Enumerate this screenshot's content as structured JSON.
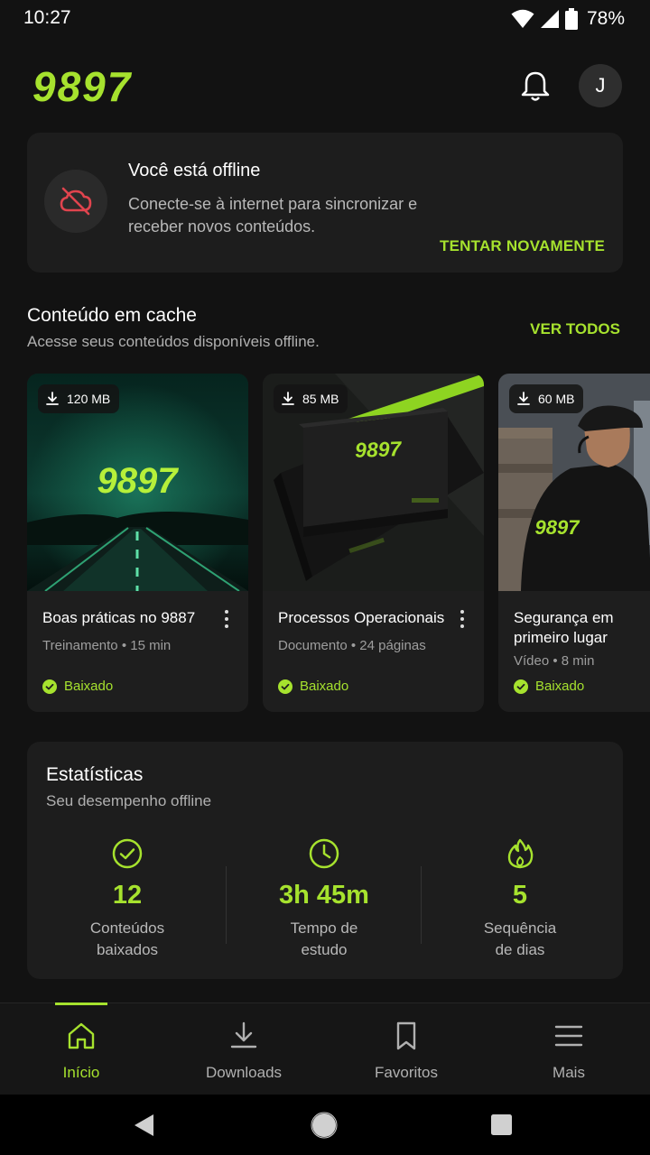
{
  "status_bar": {
    "time": "10:27",
    "battery": "78%"
  },
  "header": {
    "logo_text": "9897",
    "avatar_initial": "J"
  },
  "offline": {
    "title": "Você está offline",
    "description": "Conecte-se à internet para sincronizar e receber novos conteúdos.",
    "retry_label": "TENTAR NOVAMENTE"
  },
  "cached": {
    "title": "Conteúdo em cache",
    "subtitle": "Acesse seus conteúdos disponíveis offline.",
    "see_all_label": "VER TODOS",
    "items": [
      {
        "size": "120 MB",
        "title": "Boas práticas no 9887",
        "meta": "Treinamento • 15 min",
        "status": "Baixado",
        "image_text": "9897"
      },
      {
        "size": "85 MB",
        "title": "Processos Operacionais",
        "meta": "Documento • 24 páginas",
        "status": "Baixado",
        "image_text": "9897"
      },
      {
        "size": "60 MB",
        "title": "Segurança em primeiro lugar",
        "meta": "Vídeo • 8 min",
        "status": "Baixado",
        "image_text": "9897"
      }
    ]
  },
  "stats": {
    "title": "Estatísticas",
    "subtitle": "Seu desempenho offline",
    "items": [
      {
        "icon": "check-circle-icon",
        "value": "12",
        "label_line1": "Conteúdos",
        "label_line2": "baixados"
      },
      {
        "icon": "clock-icon",
        "value": "3h 45m",
        "label_line1": "Tempo de",
        "label_line2": "estudo"
      },
      {
        "icon": "flame-icon",
        "value": "5",
        "label_line1": "Sequência",
        "label_line2": "de dias"
      }
    ]
  },
  "bottom_nav": {
    "items": [
      {
        "label": "Início",
        "icon": "home-icon",
        "active": true
      },
      {
        "label": "Downloads",
        "icon": "download-icon",
        "active": false
      },
      {
        "label": "Favoritos",
        "icon": "bookmark-icon",
        "active": false
      },
      {
        "label": "Mais",
        "icon": "menu-icon",
        "active": false
      }
    ]
  },
  "colors": {
    "accent": "#a6e22e",
    "background": "#121212",
    "card": "#1d1d1d",
    "offline_icon": "#e0444e"
  }
}
